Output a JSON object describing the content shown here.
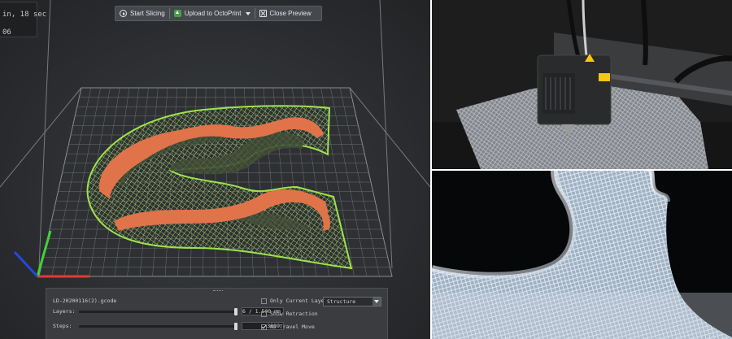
{
  "slicer": {
    "info_lines": [
      "in, 18 sec",
      "06"
    ],
    "toolbar": {
      "start_slicing": "Start Slicing",
      "upload": "Upload to OctoPrint",
      "close_preview": "Close Preview"
    },
    "panel": {
      "file_name": "LD-20200116(2).gcode",
      "layers_label": "Layers:",
      "layers_value": "6 / 1.500 mm",
      "layers_position": 1.0,
      "steps_label": "Steps:",
      "steps_value": "3099",
      "steps_position": 1.0,
      "only_current_layer": "Only Current Layer",
      "only_current_layer_checked": false,
      "show_retraction": "Show Retraction",
      "show_retraction_checked": false,
      "no_travel_move": "No Travel Move",
      "no_travel_move_checked": true,
      "view_mode": "Structure"
    },
    "colors": {
      "infill": "#9be44a",
      "wall": "#e0734a",
      "grid": "#6e7276",
      "axis_x": "#e53935",
      "axis_y": "#43d13a",
      "axis_z": "#2747e0"
    }
  },
  "photos": {
    "top": "printer-extruder-photo",
    "bottom": "printed-part-closeup-photo"
  }
}
